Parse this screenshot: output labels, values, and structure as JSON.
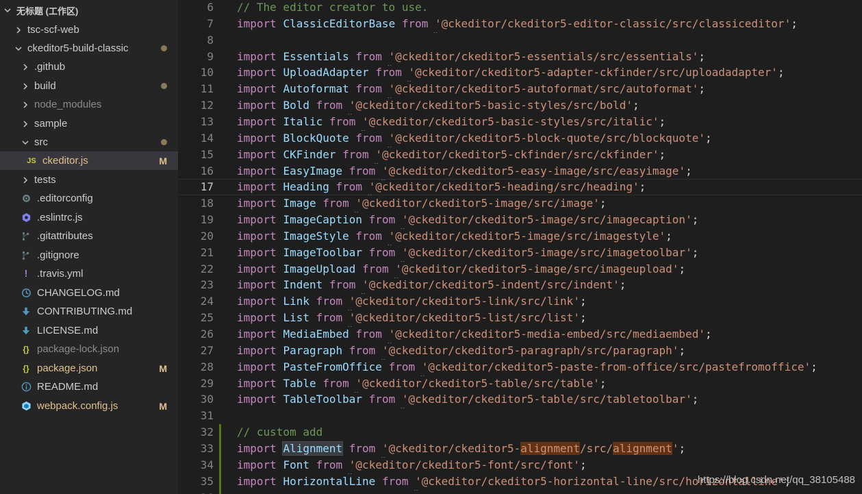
{
  "sidebar": {
    "workspace_title": "无标题 (工作区)",
    "items": [
      {
        "label": "tsc-scf-web",
        "kind": "folder",
        "expanded": false,
        "indent": 1
      },
      {
        "label": "ckeditor5-build-classic",
        "kind": "folder",
        "expanded": true,
        "indent": 1,
        "badge": "dot"
      },
      {
        "label": ".github",
        "kind": "folder",
        "expanded": false,
        "indent": 2
      },
      {
        "label": "build",
        "kind": "folder",
        "expanded": false,
        "indent": 2,
        "badge": "dot"
      },
      {
        "label": "node_modules",
        "kind": "folder",
        "expanded": false,
        "indent": 2,
        "dim": true
      },
      {
        "label": "sample",
        "kind": "folder",
        "expanded": false,
        "indent": 2
      },
      {
        "label": "src",
        "kind": "folder",
        "expanded": true,
        "indent": 2,
        "badge": "dot"
      },
      {
        "label": "ckeditor.js",
        "kind": "js",
        "indent": 3,
        "badge": "M",
        "modified": true,
        "selected": true,
        "icon_text": "JS"
      },
      {
        "label": "tests",
        "kind": "folder",
        "expanded": false,
        "indent": 2
      },
      {
        "label": ".editorconfig",
        "kind": "gear",
        "indent": 2
      },
      {
        "label": ".eslintrc.js",
        "kind": "eslint",
        "indent": 2
      },
      {
        "label": ".gitattributes",
        "kind": "git",
        "indent": 2
      },
      {
        "label": ".gitignore",
        "kind": "git",
        "indent": 2
      },
      {
        "label": ".travis.yml",
        "kind": "yml",
        "indent": 2,
        "icon_text": "!"
      },
      {
        "label": "CHANGELOG.md",
        "kind": "clock",
        "indent": 2
      },
      {
        "label": "CONTRIBUTING.md",
        "kind": "arrow",
        "indent": 2
      },
      {
        "label": "LICENSE.md",
        "kind": "arrow",
        "indent": 2
      },
      {
        "label": "package-lock.json",
        "kind": "json",
        "indent": 2,
        "dim": true,
        "icon_text": "{}"
      },
      {
        "label": "package.json",
        "kind": "json",
        "indent": 2,
        "badge": "M",
        "modified": true,
        "icon_text": "{}"
      },
      {
        "label": "README.md",
        "kind": "info",
        "indent": 2
      },
      {
        "label": "webpack.config.js",
        "kind": "webpack",
        "indent": 2,
        "badge": "M",
        "modified": true
      }
    ]
  },
  "editor": {
    "current_line": 17,
    "lines": [
      {
        "n": 6,
        "type": "comment",
        "text": "// The editor creator to use."
      },
      {
        "n": 7,
        "type": "import",
        "name": "ClassicEditorBase",
        "path": "@ckeditor/ckeditor5-editor-classic/src/classiceditor"
      },
      {
        "n": 8,
        "type": "blank"
      },
      {
        "n": 9,
        "type": "import",
        "name": "Essentials",
        "path": "@ckeditor/ckeditor5-essentials/src/essentials"
      },
      {
        "n": 10,
        "type": "import",
        "name": "UploadAdapter",
        "path": "@ckeditor/ckeditor5-adapter-ckfinder/src/uploadadapter"
      },
      {
        "n": 11,
        "type": "import",
        "name": "Autoformat",
        "path": "@ckeditor/ckeditor5-autoformat/src/autoformat"
      },
      {
        "n": 12,
        "type": "import",
        "name": "Bold",
        "path": "@ckeditor/ckeditor5-basic-styles/src/bold"
      },
      {
        "n": 13,
        "type": "import",
        "name": "Italic",
        "path": "@ckeditor/ckeditor5-basic-styles/src/italic"
      },
      {
        "n": 14,
        "type": "import",
        "name": "BlockQuote",
        "path": "@ckeditor/ckeditor5-block-quote/src/blockquote"
      },
      {
        "n": 15,
        "type": "import",
        "name": "CKFinder",
        "path": "@ckeditor/ckeditor5-ckfinder/src/ckfinder"
      },
      {
        "n": 16,
        "type": "import",
        "name": "EasyImage",
        "path": "@ckeditor/ckeditor5-easy-image/src/easyimage"
      },
      {
        "n": 17,
        "type": "import",
        "name": "Heading",
        "path": "@ckeditor/ckeditor5-heading/src/heading"
      },
      {
        "n": 18,
        "type": "import",
        "name": "Image",
        "path": "@ckeditor/ckeditor5-image/src/image"
      },
      {
        "n": 19,
        "type": "import",
        "name": "ImageCaption",
        "path": "@ckeditor/ckeditor5-image/src/imagecaption"
      },
      {
        "n": 20,
        "type": "import",
        "name": "ImageStyle",
        "path": "@ckeditor/ckeditor5-image/src/imagestyle"
      },
      {
        "n": 21,
        "type": "import",
        "name": "ImageToolbar",
        "path": "@ckeditor/ckeditor5-image/src/imagetoolbar"
      },
      {
        "n": 22,
        "type": "import",
        "name": "ImageUpload",
        "path": "@ckeditor/ckeditor5-image/src/imageupload"
      },
      {
        "n": 23,
        "type": "import",
        "name": "Indent",
        "path": "@ckeditor/ckeditor5-indent/src/indent"
      },
      {
        "n": 24,
        "type": "import",
        "name": "Link",
        "path": "@ckeditor/ckeditor5-link/src/link"
      },
      {
        "n": 25,
        "type": "import",
        "name": "List",
        "path": "@ckeditor/ckeditor5-list/src/list"
      },
      {
        "n": 26,
        "type": "import",
        "name": "MediaEmbed",
        "path": "@ckeditor/ckeditor5-media-embed/src/mediaembed"
      },
      {
        "n": 27,
        "type": "import",
        "name": "Paragraph",
        "path": "@ckeditor/ckeditor5-paragraph/src/paragraph"
      },
      {
        "n": 28,
        "type": "import",
        "name": "PasteFromOffice",
        "path": "@ckeditor/ckeditor5-paste-from-office/src/pastefromoffice"
      },
      {
        "n": 29,
        "type": "import",
        "name": "Table",
        "path": "@ckeditor/ckeditor5-table/src/table"
      },
      {
        "n": 30,
        "type": "import",
        "name": "TableToolbar",
        "path": "@ckeditor/ckeditor5-table/src/tabletoolbar"
      },
      {
        "n": 31,
        "type": "blank"
      },
      {
        "n": 32,
        "type": "comment",
        "text": "// custom add",
        "added": true
      },
      {
        "n": 33,
        "type": "import",
        "name": "Alignment",
        "path_parts": [
          "@ckeditor/ckeditor5-",
          "alignment",
          "/src/",
          "alignment",
          ""
        ],
        "added": true,
        "highlight": true
      },
      {
        "n": 34,
        "type": "import",
        "name": "Font",
        "path": "@ckeditor/ckeditor5-font/src/font",
        "added": true
      },
      {
        "n": 35,
        "type": "import",
        "name": "HorizontalLine",
        "path": "@ckeditor/ckeditor5-horizontal-line/src/horizontalline",
        "added": true
      },
      {
        "n": 36,
        "type": "blank",
        "added": true
      }
    ],
    "keywords": {
      "import": "import",
      "from": "from"
    }
  },
  "watermark": "https://blog.csdn.net/qq_38105488",
  "colors": {
    "sidebar_bg": "#252526",
    "editor_bg": "#1e1e1e",
    "keyword": "#c586c0",
    "identifier": "#9cdcfe",
    "string": "#ce9178",
    "comment": "#6a9955",
    "modified": "#e2c08d",
    "added_gutter": "#587c0c"
  }
}
